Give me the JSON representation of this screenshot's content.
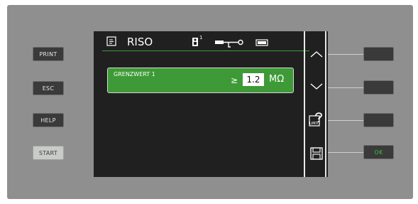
{
  "left_buttons": [
    {
      "label": "PRINT"
    },
    {
      "label": "ESC"
    },
    {
      "label": "HELP"
    },
    {
      "label": "START"
    }
  ],
  "screen": {
    "title": "RISO",
    "header_icons": [
      "document-icon",
      "probe-one-icon",
      "test-lead-icon",
      "battery-icon"
    ],
    "probe_number": "1",
    "limit": {
      "label": "GRENZWERT 1",
      "operator": "≥",
      "value": "1.2",
      "unit": "MΩ"
    },
    "side_buttons": [
      {
        "icon": "arrow-up-icon"
      },
      {
        "icon": "arrow-down-icon"
      },
      {
        "icon": "limit-icon",
        "label": "LIMIT"
      },
      {
        "icon": "save-icon"
      }
    ]
  },
  "right_buttons": [
    {
      "label": ""
    },
    {
      "label": ""
    },
    {
      "label": ""
    },
    {
      "label": "OK"
    }
  ],
  "colors": {
    "accent_green": "#3e9a37",
    "ok_green": "#3fbf3a",
    "screen_bg": "#202020",
    "panel_bg": "#8f8f8f"
  }
}
